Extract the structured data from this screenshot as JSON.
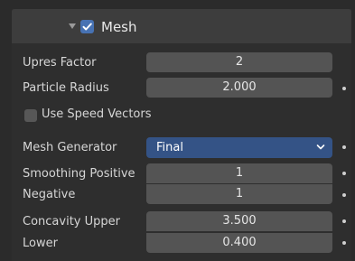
{
  "panel": {
    "title": "Mesh",
    "enabled": true,
    "accent_color": "#4772b3"
  },
  "fields": {
    "upres_factor": {
      "label": "Upres Factor",
      "value": "2"
    },
    "particle_radius": {
      "label": "Particle Radius",
      "value": "2.000"
    },
    "use_speed_vectors": {
      "label": "Use Speed Vectors",
      "checked": false
    },
    "mesh_generator": {
      "label": "Mesh Generator",
      "value": "Final"
    },
    "smoothing_positive": {
      "label": "Smoothing Positive",
      "value": "1"
    },
    "smoothing_negative": {
      "label": "Negative",
      "value": "1"
    },
    "concavity_upper": {
      "label": "Concavity Upper",
      "value": "3.500"
    },
    "concavity_lower": {
      "label": "Lower",
      "value": "0.400"
    }
  },
  "icons": {
    "collapse": "triangle-down-icon",
    "enable_checkbox": "checkbox-checked-icon",
    "dropdown": "chevron-down-icon",
    "keyframe": "animate-dot-icon"
  }
}
